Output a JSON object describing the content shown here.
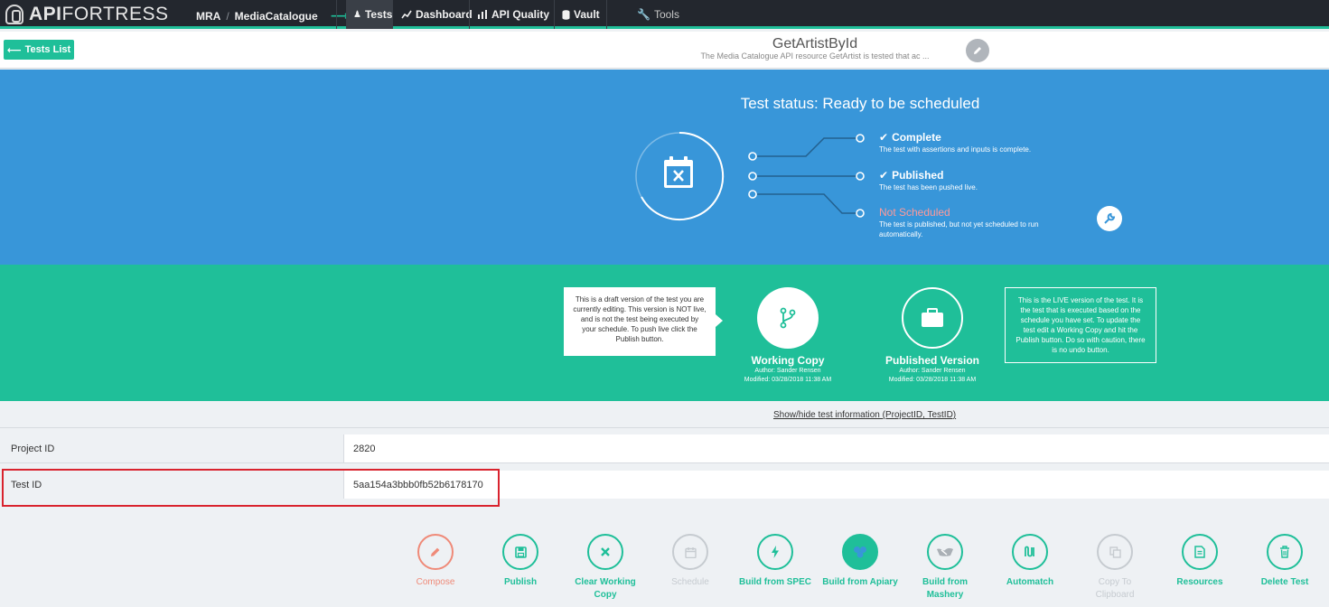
{
  "nav": {
    "logo_api": "API",
    "logo_fortress": "FORTRESS",
    "project": "MRA",
    "separator": "/",
    "collection": "MediaCatalogue",
    "items": {
      "tests": "Tests",
      "dashboard": "Dashboard",
      "quality": "API Quality",
      "vault": "Vault",
      "tools": "Tools"
    }
  },
  "titlebar": {
    "back_label": "Tests List",
    "title": "GetArtistById",
    "description": "The Media Catalogue API resource GetArtist is tested that ac ..."
  },
  "status": {
    "heading": "Test status: Ready to be scheduled",
    "steps": [
      {
        "name": "Complete",
        "desc": "The test with assertions and inputs is complete."
      },
      {
        "name": "Published",
        "desc": "The test has been pushed live."
      },
      {
        "name": "Not Scheduled",
        "desc": "The test is published, but not yet scheduled to run automatically."
      }
    ]
  },
  "versions": {
    "draft_note": "This is a draft version of the test you are currently editing. This version is NOT live, and is not the test being executed by your schedule. To push live click the Publish button.",
    "live_note": "This is the LIVE version of the test. It is the test that is executed based on the schedule you have set. To update the test edit a Working Copy and hit the Publish button. Do so with caution, there is no undo button.",
    "working": {
      "title": "Working Copy",
      "author": "Author: Sander Rensen",
      "modified": "Modified: 03/28/2018 11:38 AM"
    },
    "published": {
      "title": "Published Version",
      "author": "Author: Sander Rensen",
      "modified": "Modified: 03/28/2018 11:38 AM"
    }
  },
  "info": {
    "toggle": "Show/hide test information (ProjectID, TestID)",
    "project_label": "Project ID",
    "project_value": "2820",
    "test_label": "Test ID",
    "test_value": "5aa154a3bbb0fb52b6178170"
  },
  "actions": {
    "compose": "Compose",
    "publish": "Publish",
    "clear1": "Clear Working",
    "clear2": "Copy",
    "schedule": "Schedule",
    "spec": "Build from SPEC",
    "apiary": "Build from Apiary",
    "mashery1": "Build from",
    "mashery2": "Mashery",
    "automatch": "Automatch",
    "copy1": "Copy To",
    "copy2": "Clipboard",
    "resources": "Resources",
    "delete": "Delete Test"
  },
  "colors": {
    "accent": "#1fbf99",
    "blue": "#3896d9",
    "navbar": "#23272e",
    "warn": "#ff9a9a",
    "highlight": "#d9232e"
  }
}
